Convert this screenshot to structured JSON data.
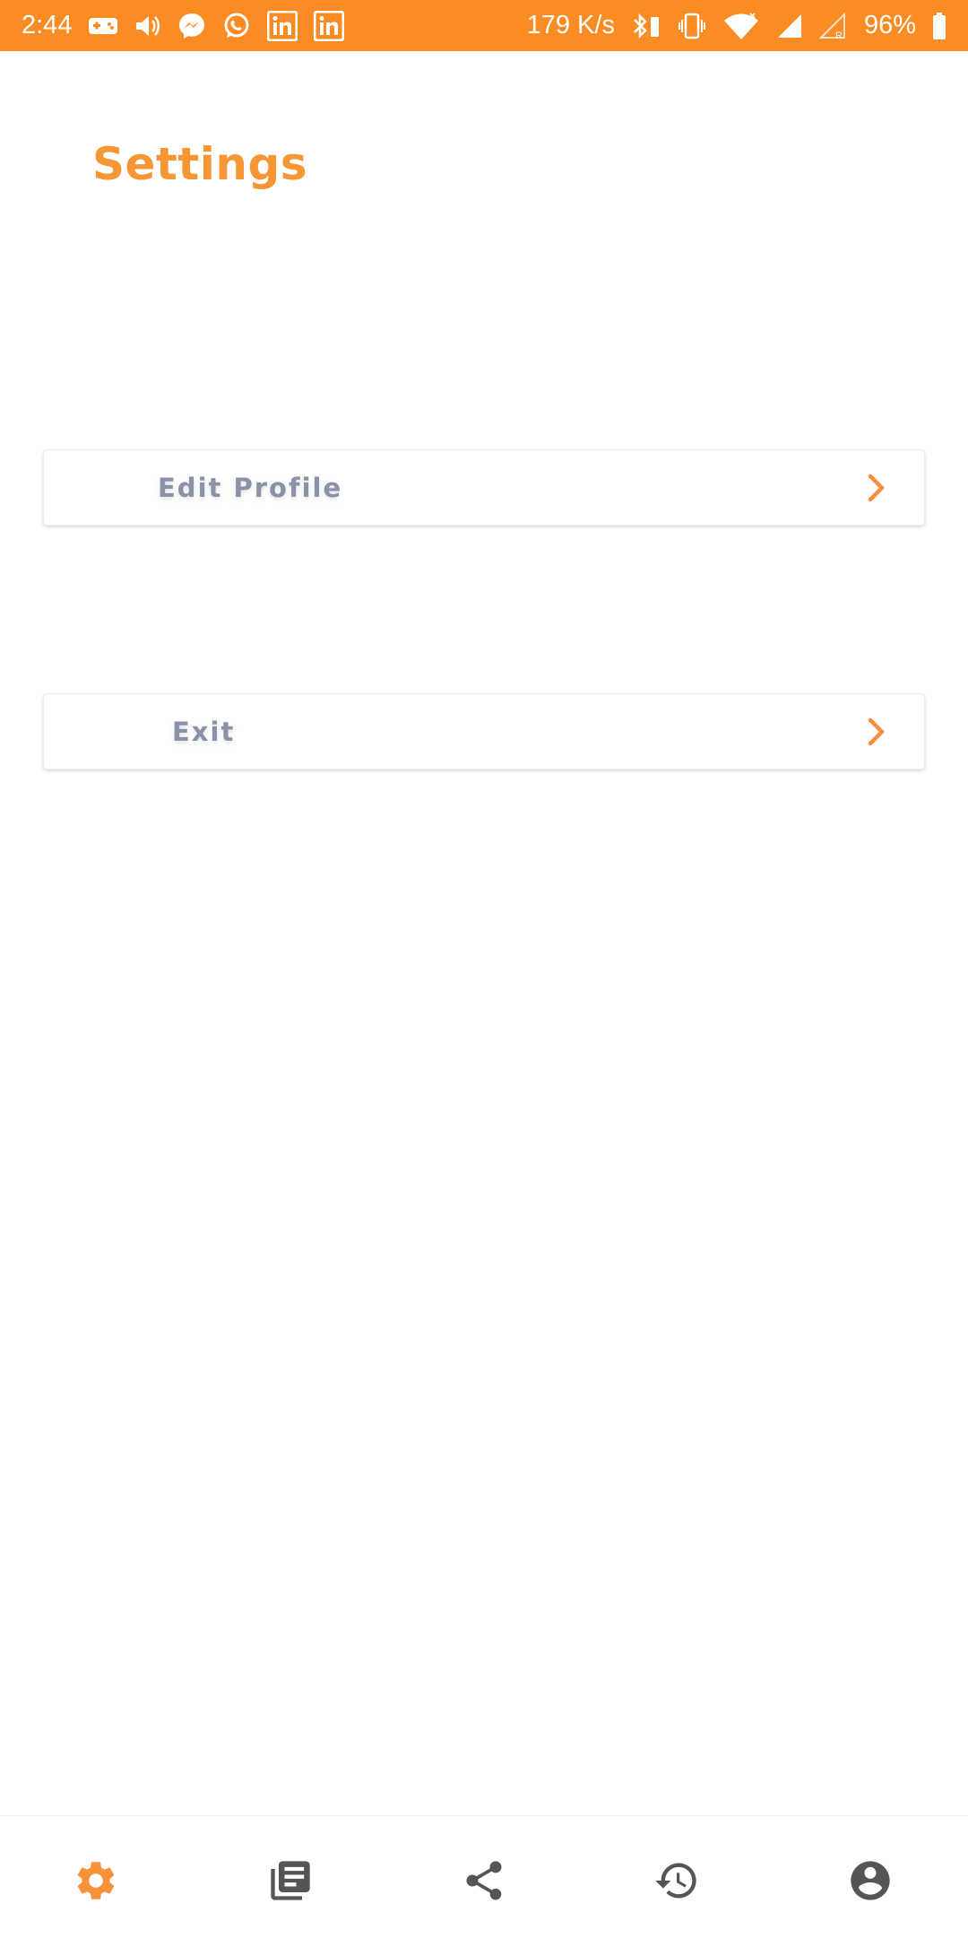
{
  "status_bar": {
    "time": "2:44",
    "net_speed": "179 K/s",
    "battery": "96%",
    "left_icons": [
      "game-controller-icon",
      "volume-icon",
      "messenger-icon",
      "whatsapp-icon",
      "linkedin-icon",
      "linkedin-icon"
    ],
    "right_icons": [
      "bluetooth-icon",
      "vibrate-icon",
      "wifi-icon",
      "signal-icon",
      "signal-roaming-icon",
      "battery-icon"
    ]
  },
  "header": {
    "title": "Settings"
  },
  "menu": {
    "items": [
      {
        "label": "Edit Profile",
        "icon": "chevron-right-icon"
      },
      {
        "label": "Exit",
        "icon": "chevron-right-icon"
      }
    ]
  },
  "bottom_nav": {
    "items": [
      {
        "icon": "gear-icon",
        "active": true
      },
      {
        "icon": "news-list-icon",
        "active": false
      },
      {
        "icon": "share-icon",
        "active": false
      },
      {
        "icon": "history-icon",
        "active": false
      },
      {
        "icon": "account-icon",
        "active": false
      }
    ]
  },
  "colors": {
    "accent": "#fb8c23",
    "title": "#f79634",
    "menu_label": "#8a92a8",
    "nav_inactive": "#555555"
  }
}
